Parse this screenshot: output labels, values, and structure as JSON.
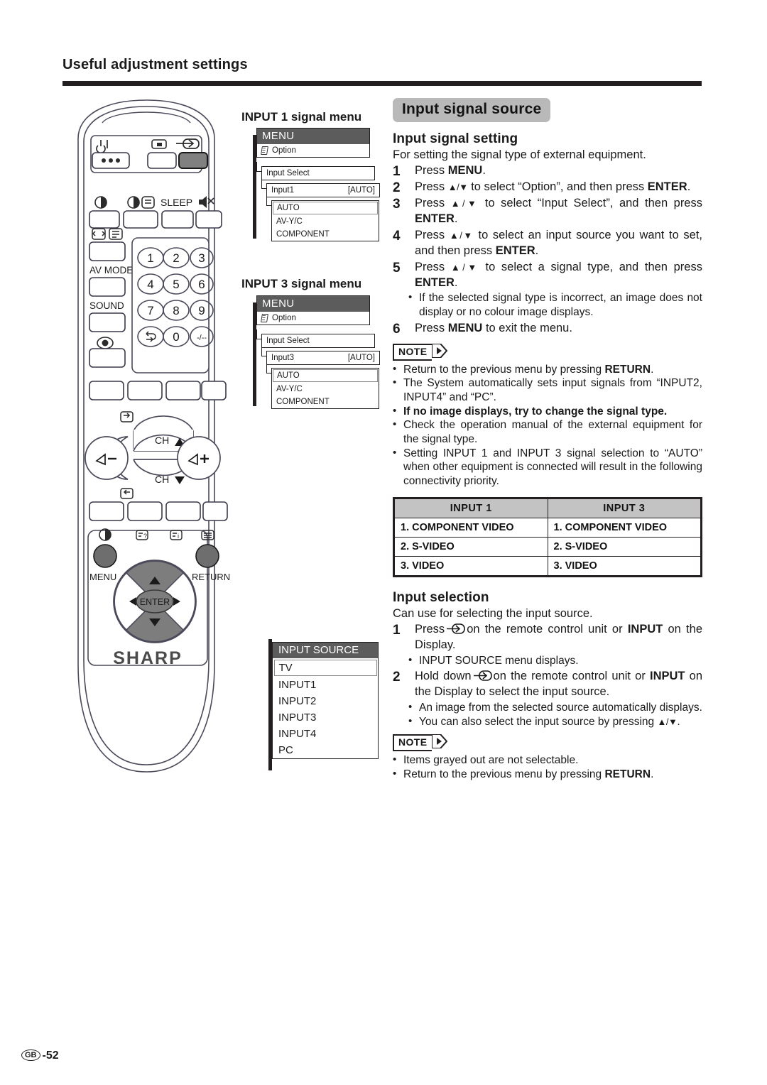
{
  "page": {
    "title": "Useful adjustment settings",
    "footer_region": "GB",
    "footer_page": "-52"
  },
  "remote": {
    "brand": "SHARP",
    "labels": {
      "sleep": "SLEEP",
      "av_mode": "AV MODE",
      "sound": "SOUND",
      "ch_up": "CH",
      "ch_down": "CH",
      "enter": "ENTER",
      "menu": "MENU",
      "return": "RETURN",
      "vol_minus": "−",
      "vol_plus": "+"
    },
    "keypad": [
      "1",
      "2",
      "3",
      "4",
      "5",
      "6",
      "7",
      "8",
      "9",
      "0",
      "-/--"
    ]
  },
  "input1_menu": {
    "caption": "INPUT 1 signal menu",
    "title": "MENU",
    "option_row": "Option",
    "input_select_row": "Input Select",
    "input_row_label": "Input1",
    "input_row_value": "[AUTO]",
    "options": [
      "AUTO",
      "AV-Y/C",
      "COMPONENT"
    ],
    "selected_option": "AUTO"
  },
  "input3_menu": {
    "caption": "INPUT 3 signal menu",
    "title": "MENU",
    "option_row": "Option",
    "input_select_row": "Input Select",
    "input_row_label": "Input3",
    "input_row_value": "[AUTO]",
    "options": [
      "AUTO",
      "AV-Y/C",
      "COMPONENT"
    ],
    "selected_option": "AUTO"
  },
  "input_source_menu": {
    "title": "INPUT SOURCE",
    "items": [
      "TV",
      "INPUT1",
      "INPUT2",
      "INPUT3",
      "INPUT4",
      "PC"
    ],
    "selected": "TV"
  },
  "section": {
    "badge": "Input signal source"
  },
  "input_signal_setting": {
    "heading": "Input signal setting",
    "lead": "For setting the signal type of external equipment.",
    "steps": [
      {
        "num": "1",
        "text": "Press MENU."
      },
      {
        "num": "2",
        "text": "Press ▲/▼ to select “Option”, and then press ENTER."
      },
      {
        "num": "3",
        "text": "Press ▲/▼ to select “Input Select”, and then press ENTER."
      },
      {
        "num": "4",
        "text": "Press ▲/▼ to select an input source you want to set, and then press ENTER."
      },
      {
        "num": "5",
        "text": "Press ▲/▼ to select a signal type, and then press ENTER."
      }
    ],
    "step5_bullet": "If the selected signal type is incorrect, an image does not display or no colour image displays.",
    "step6_num": "6",
    "step6_text": "Press MENU to exit the menu.",
    "note_label": "NOTE",
    "notes": [
      "Return to the previous menu by pressing RETURN.",
      "The System automatically sets input signals from “INPUT2, INPUT4” and “PC”.",
      "If no image displays, try to change the signal type.",
      "Check the operation manual of the external equipment for the signal type.",
      "Setting INPUT 1 and INPUT 3 signal selection to “AUTO” when other equipment is connected will result in the following connectivity priority."
    ]
  },
  "priority_table": {
    "headers": [
      "INPUT 1",
      "INPUT 3"
    ],
    "rows": [
      [
        "1. COMPONENT VIDEO",
        "1. COMPONENT VIDEO"
      ],
      [
        "2. S-VIDEO",
        "2. S-VIDEO"
      ],
      [
        "3. VIDEO",
        "3. VIDEO"
      ]
    ]
  },
  "input_selection": {
    "heading": "Input selection",
    "lead": "Can use for selecting the input source.",
    "step1_num": "1",
    "step1_pre": "Press",
    "step1_post": "on the remote control unit or INPUT on the Display.",
    "step1_bullet": "INPUT SOURCE menu displays.",
    "step2_num": "2",
    "step2_pre": "Hold down",
    "step2_post": "on the remote control unit or INPUT on the Display to select the input source.",
    "step2_bullets": [
      "An image from the selected source automatically displays.",
      "You can also select the input source by pressing ▲/▼."
    ],
    "note_label": "NOTE",
    "notes": [
      "Items grayed out are not selectable.",
      "Return to the previous menu by pressing RETURN."
    ]
  },
  "colors": {
    "menu_header_bg": "#5c5c5c",
    "badge_bg": "#b9b9b9",
    "table_header_bg": "#c3c3c3",
    "rule": "#231f20"
  }
}
